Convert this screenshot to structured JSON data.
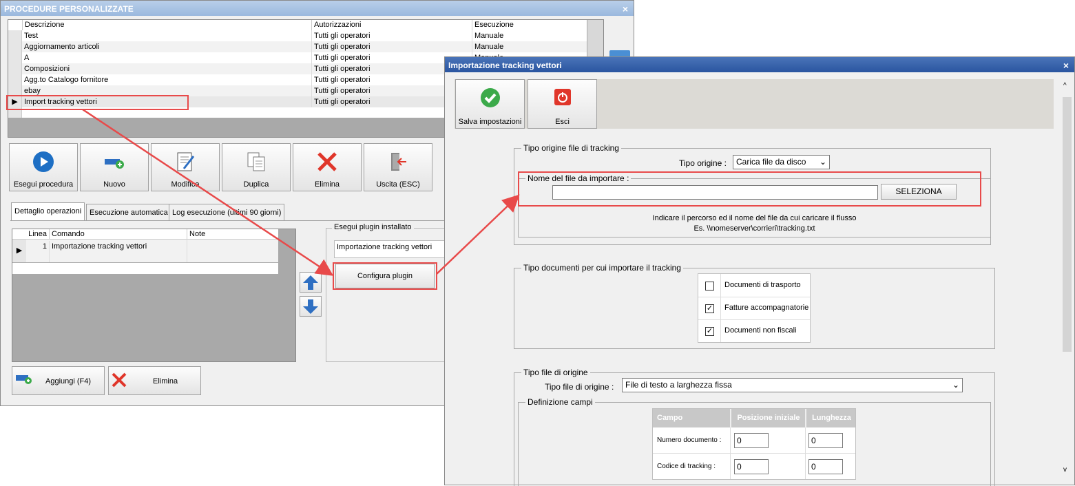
{
  "win1": {
    "title": "PROCEDURE PERSONALIZZATE",
    "close": "×",
    "grid_headers": [
      "Descrizione",
      "Autorizzazioni",
      "Esecuzione"
    ],
    "rows": [
      {
        "desc": "Test",
        "auth": "Tutti gli operatori",
        "exec": "Manuale"
      },
      {
        "desc": "Aggiornamento articoli",
        "auth": "Tutti gli operatori",
        "exec": "Manuale"
      },
      {
        "desc": "A",
        "auth": "Tutti gli operatori",
        "exec": "Manuale"
      },
      {
        "desc": "Composizioni",
        "auth": "Tutti gli operatori",
        "exec": ""
      },
      {
        "desc": "Agg.to Catalogo fornitore",
        "auth": "Tutti gli operatori",
        "exec": ""
      },
      {
        "desc": "ebay",
        "auth": "Tutti gli operatori",
        "exec": ""
      },
      {
        "desc": "Import tracking vettori",
        "auth": "Tutti gli operatori",
        "exec": ""
      }
    ],
    "toolbar": {
      "run": "Esegui procedura",
      "new": "Nuovo",
      "edit": "Modifica",
      "duplicate": "Duplica",
      "delete": "Elimina",
      "exit": "Uscita (ESC)"
    },
    "tabs": [
      "Dettaglio operazioni",
      "Esecuzione automatica",
      "Log esecuzione (ultimi 90 giorni)"
    ],
    "ops_headers": [
      "Linea",
      "Comando",
      "Note"
    ],
    "ops_rows": [
      {
        "line": "1",
        "cmd": "Importazione tracking vettori",
        "note": ""
      }
    ],
    "plugin_group": "Esegui plugin installato",
    "plugin_name": "Importazione tracking vettori",
    "configure": "Configura plugin",
    "add": "Aggiungi (F4)",
    "remove": "Elimina"
  },
  "win2": {
    "title": "Importazione tracking vettori",
    "close": "×",
    "save": "Salva impostazioni",
    "exit": "Esci",
    "origin_group": "Tipo origine file di tracking",
    "origin_label": "Tipo origine :",
    "origin_value": "Carica file da disco",
    "file_group": "Nome del file da importare :",
    "file_value": "",
    "select_btn": "SELEZIONA",
    "hint1": "Indicare il percorso ed il nome del file da cui caricare il flusso",
    "hint2": "Es. \\\\nomeserver\\corrieri\\tracking.txt",
    "docs_group": "Tipo documenti per cui importare il tracking",
    "docs": [
      {
        "label": "Documenti di trasporto",
        "checked": false
      },
      {
        "label": "Fatture accompagnatorie",
        "checked": true
      },
      {
        "label": "Documenti non fiscali",
        "checked": true
      }
    ],
    "filetype_group": "Tipo file di origine",
    "filetype_label": "Tipo file di origine :",
    "filetype_value": "File di testo a larghezza fissa",
    "fields_group": "Definizione campi",
    "fields_headers": [
      "Campo",
      "Posizione iniziale",
      "Lunghezza"
    ],
    "fields": [
      {
        "name": "Numero documento :",
        "pos": "0",
        "len": "0"
      },
      {
        "name": "Codice di tracking :",
        "pos": "0",
        "len": "0"
      }
    ]
  },
  "colors": {
    "highlight_red": "#e84a4a",
    "title_blue": "#2a55a0",
    "title_light": "#9ab8de"
  }
}
